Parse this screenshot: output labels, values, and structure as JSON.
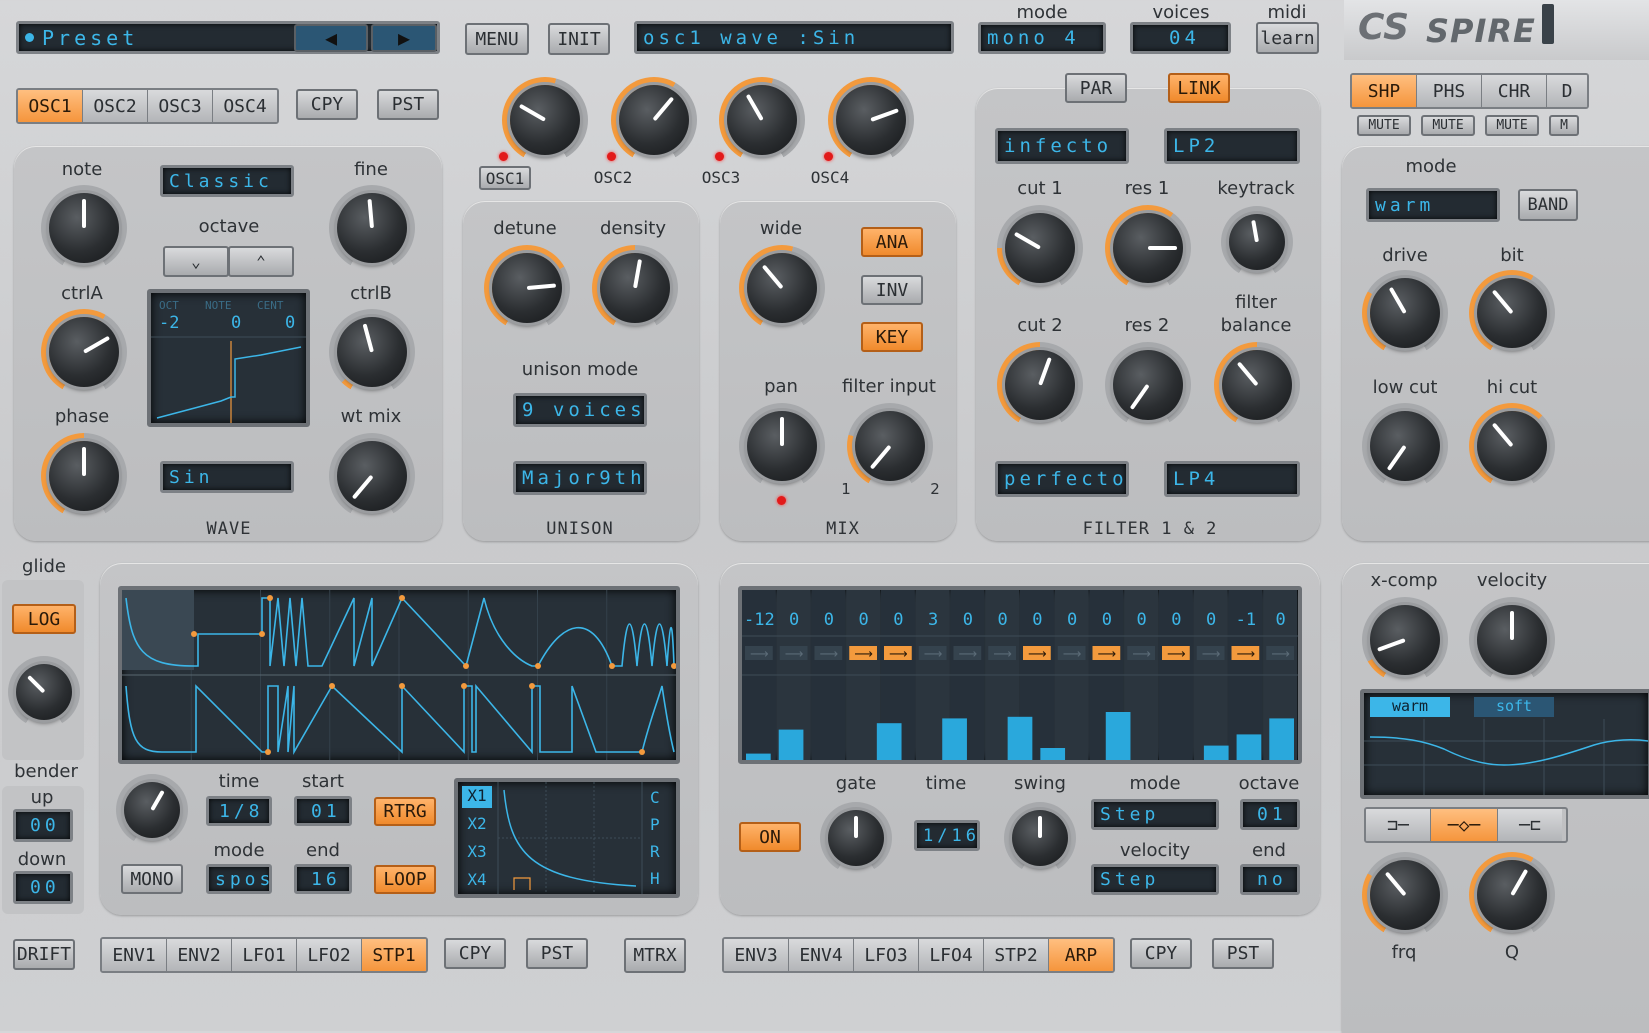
{
  "top": {
    "preset_label": "Preset",
    "menu": "MENU",
    "init": "INIT",
    "param_display": "osc1 wave   :Sin",
    "mode_label": "mode",
    "mode_value": "mono 4",
    "voices_label": "voices",
    "voices_value": "04",
    "midi_label": "midi",
    "midi_value": "learn",
    "logo": "SPIRE"
  },
  "osc": {
    "tabs": [
      "OSC1",
      "OSC2",
      "OSC3",
      "OSC4"
    ],
    "active_tab": 0,
    "copy": "CPY",
    "paste": "PST",
    "mix_labels": [
      "OSC1",
      "OSC2",
      "OSC3",
      "OSC4"
    ]
  },
  "wave": {
    "note": "note",
    "fine": "fine",
    "ctrlA": "ctrlA",
    "ctrlB": "ctrlB",
    "phase": "phase",
    "wt_mix": "wt mix",
    "type": "Classic",
    "octave": "octave",
    "wave_select": "Sin",
    "section": "WAVE",
    "oct_label": "OCT",
    "note_label": "NOTE",
    "cent_label": "CENT",
    "oct_value": "-2",
    "note_value": "0",
    "cent_value": "0"
  },
  "unison": {
    "detune": "detune",
    "density": "density",
    "mode_label": "unison mode",
    "mode_value": "9 voices",
    "chord": "Major9th",
    "section": "UNISON"
  },
  "mix": {
    "wide": "wide",
    "pan": "pan",
    "filter_input": "filter input",
    "ana": "ANA",
    "inv": "INV",
    "key": "KEY",
    "in1": "1",
    "in2": "2",
    "section": "MIX"
  },
  "filter": {
    "par": "PAR",
    "link": "LINK",
    "f1_type": "infecto",
    "f1_mode": "LP2",
    "cut1": "cut 1",
    "res1": "res 1",
    "keytrack": "keytrack",
    "cut2": "cut 2",
    "res2": "res 2",
    "balance1": "filter",
    "balance2": "balance",
    "f2_type": "perfecto",
    "f2_mode": "LP4",
    "section": "FILTER 1 & 2"
  },
  "fx": {
    "tabs": [
      "SHP",
      "PHS",
      "CHR",
      "D"
    ],
    "active_tab": 0,
    "mute": [
      "MUTE",
      "MUTE",
      "MUTE",
      "M"
    ],
    "mode": "mode",
    "mode_value": "warm",
    "band": "BAND",
    "drive": "drive",
    "bit": "bit",
    "low_cut": "low cut",
    "hi_cut": "hi cut"
  },
  "glide": {
    "label": "glide",
    "log": "LOG",
    "bender": "bender",
    "up": "up",
    "up_value": "00",
    "down": "down",
    "down_value": "00",
    "drift": "DRIFT"
  },
  "env": {
    "time": "time",
    "time_value": "1/8",
    "start": "start",
    "start_value": "01",
    "rtrg": "RTRG",
    "mode": "mode",
    "mode_value": "spos",
    "end": "end",
    "end_value": "16",
    "loop": "LOOP",
    "mono": "MONO",
    "x_labels": [
      "X1",
      "X2",
      "X3",
      "X4"
    ],
    "side_labels": [
      "C",
      "P",
      "R",
      "H"
    ],
    "tabs": [
      "ENV1",
      "ENV2",
      "LFO1",
      "LFO2",
      "STP1"
    ],
    "active_tab": 4,
    "copy": "CPY",
    "paste": "PST"
  },
  "arp": {
    "steps": [
      "-12",
      "0",
      "0",
      "0",
      "0",
      "3",
      "0",
      "0",
      "0",
      "0",
      "0",
      "0",
      "0",
      "0",
      "-1",
      "0"
    ],
    "arrows": [
      false,
      false,
      false,
      true,
      true,
      false,
      false,
      false,
      true,
      false,
      true,
      false,
      true,
      false,
      true,
      false
    ],
    "vel": [
      0.08,
      0.38,
      0,
      0,
      0.46,
      0,
      0.52,
      0,
      0.54,
      0.15,
      0,
      0.6,
      0,
      0,
      0.18,
      0.32,
      0.52
    ],
    "on": "ON",
    "gate": "gate",
    "time": "time",
    "time_value": "1/16",
    "swing": "swing",
    "mode": "mode",
    "mode_value": "Step",
    "octave": "octave",
    "octave_value": "01",
    "velocity": "velocity",
    "velocity_value": "Step",
    "end": "end",
    "end_value": "no",
    "tabs": [
      "ENV3",
      "ENV4",
      "LFO3",
      "LFO4",
      "STP2",
      "ARP"
    ],
    "active_tab": 5,
    "copy": "CPY",
    "paste": "PST",
    "matrix": "MTRX"
  },
  "right": {
    "xcomp": "x-comp",
    "velocity": "velocity",
    "warm": "warm",
    "soft": "soft",
    "frq": "frq",
    "q": "Q"
  },
  "colors": {
    "accent": "#f39a3d",
    "lcd_text": "#3cb6e8",
    "lcd_bg": "#232b32"
  }
}
